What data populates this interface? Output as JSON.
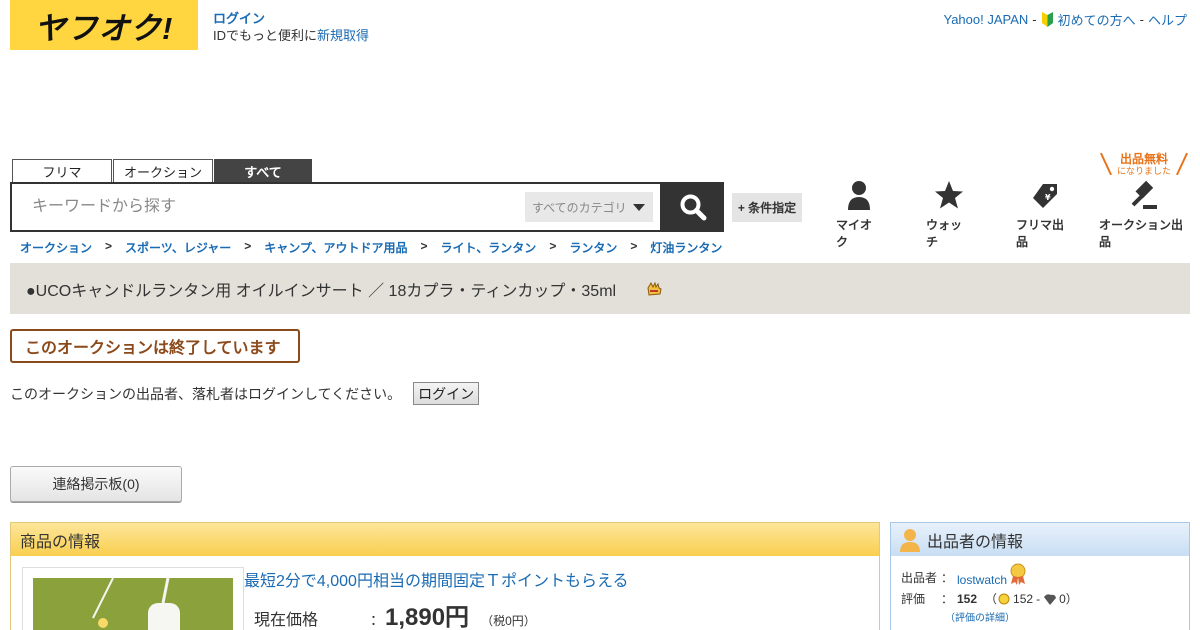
{
  "header": {
    "logo_text": "ヤフオク!",
    "login_link": "ログイン",
    "login_prompt_prefix": "IDでもっと便利に",
    "signup_link": "新規取得",
    "top_links": {
      "yahoo_japan": "Yahoo! JAPAN",
      "beginners": "初めての方へ",
      "help": "ヘルプ",
      "separator": "-"
    }
  },
  "search": {
    "tabs": [
      "フリマ",
      "オークション",
      "すべて"
    ],
    "active_tab": "すべて",
    "placeholder": "キーワードから探す",
    "category": "すべてのカテゴリ",
    "conditions_button": "+ 条件指定"
  },
  "nav": {
    "myauc": "マイオク",
    "watch": "ウォッチ",
    "flea_listing": "フリマ出品",
    "auction_listing": "オークション出品",
    "free_listing_line1": "出品無料",
    "free_listing_line2": "になりました"
  },
  "breadcrumb": {
    "items": [
      "オークション",
      "スポーツ、レジャー",
      "キャンプ、アウトドア用品",
      "ライト、ランタン",
      "ランタン",
      "灯油ランタン"
    ],
    "separator": ">"
  },
  "item": {
    "title": "●UCOキャンドルランタン用 オイルインサート ／ 18カプラ・ティンカップ・35ml",
    "ended_notice": "このオークションは終了しています",
    "login_message": "このオークションの出品者、落札者はログインしてください。",
    "login_button": "ログイン",
    "board_button": "連絡掲示板(0)"
  },
  "item_info": {
    "header": "商品の情報",
    "promo": "最短2分で4,000円相当の期間固定Ｔポイントもらえる",
    "price_label": "現在価格",
    "colon": "：",
    "price": "1,890円",
    "tax": "（税0円）"
  },
  "seller": {
    "header": "出品者の情報",
    "seller_label": "出品者",
    "colon": "：",
    "seller_name": "lostwatch",
    "rating_label": "評価",
    "rating_total": "152",
    "rating_paren_open": "（",
    "rating_good": "152",
    "rating_dash": "-",
    "rating_bad": "0",
    "rating_paren_close": "）",
    "rating_detail": "（評価の詳細）"
  },
  "colors": {
    "logo_bg": "#ffd640",
    "link": "#1a6bb3",
    "ended_border": "#8b4a1c",
    "item_header": "#f9cf4f",
    "seller_header": "#c8def4",
    "free_listing": "#e8731a"
  }
}
